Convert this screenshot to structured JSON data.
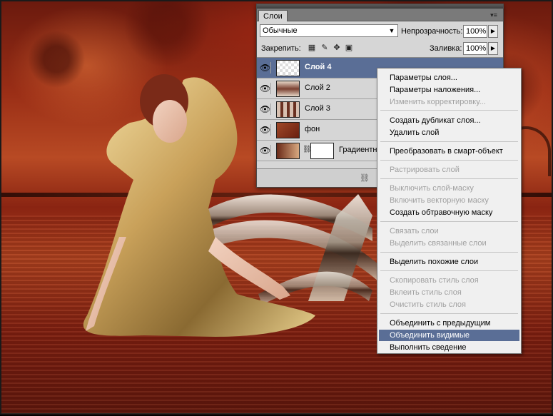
{
  "panel": {
    "tab_label": "Слои",
    "menu_icon": "panel-menu-icon",
    "blend_mode": "Обычные",
    "opacity_label": "Непрозрачность:",
    "opacity_value": "100%",
    "lock_label": "Закрепить:",
    "fill_label": "Заливка:",
    "fill_value": "100%",
    "layers": [
      {
        "name": "Слой 4",
        "selected": true
      },
      {
        "name": "Слой 2",
        "selected": false
      },
      {
        "name": "Слой 3",
        "selected": false
      },
      {
        "name": "фон",
        "selected": false
      },
      {
        "name": "Градиентна",
        "selected": false
      }
    ]
  },
  "context_menu": {
    "items": [
      {
        "label": "Параметры слоя...",
        "disabled": false
      },
      {
        "label": "Параметры наложения...",
        "disabled": false
      },
      {
        "label": "Изменить корректировку...",
        "disabled": true
      },
      {
        "label": "Создать дубликат слоя...",
        "disabled": false
      },
      {
        "label": "Удалить слой",
        "disabled": false
      },
      {
        "label": "Преобразовать в смарт-объект",
        "disabled": false
      },
      {
        "label": "Растрировать слой",
        "disabled": true
      },
      {
        "label": "Выключить слой-маску",
        "disabled": true
      },
      {
        "label": "Включить векторную маску",
        "disabled": true
      },
      {
        "label": "Создать обтравочную маску",
        "disabled": false
      },
      {
        "label": "Связать слои",
        "disabled": true
      },
      {
        "label": "Выделить связанные слои",
        "disabled": true
      },
      {
        "label": "Выделить похожие слои",
        "disabled": false
      },
      {
        "label": "Скопировать стиль слоя",
        "disabled": true
      },
      {
        "label": "Вклеить стиль слоя",
        "disabled": true
      },
      {
        "label": "Очистить стиль слоя",
        "disabled": true
      },
      {
        "label": "Объединить с предыдущим",
        "disabled": false
      },
      {
        "label": "Объединить видимые",
        "disabled": false,
        "highlighted": true
      },
      {
        "label": "Выполнить сведение",
        "disabled": false
      }
    ]
  },
  "colors": {
    "selection": "#5a6e96",
    "panel_bg": "#d6d6d6",
    "menu_bg": "#f0f0f0"
  }
}
